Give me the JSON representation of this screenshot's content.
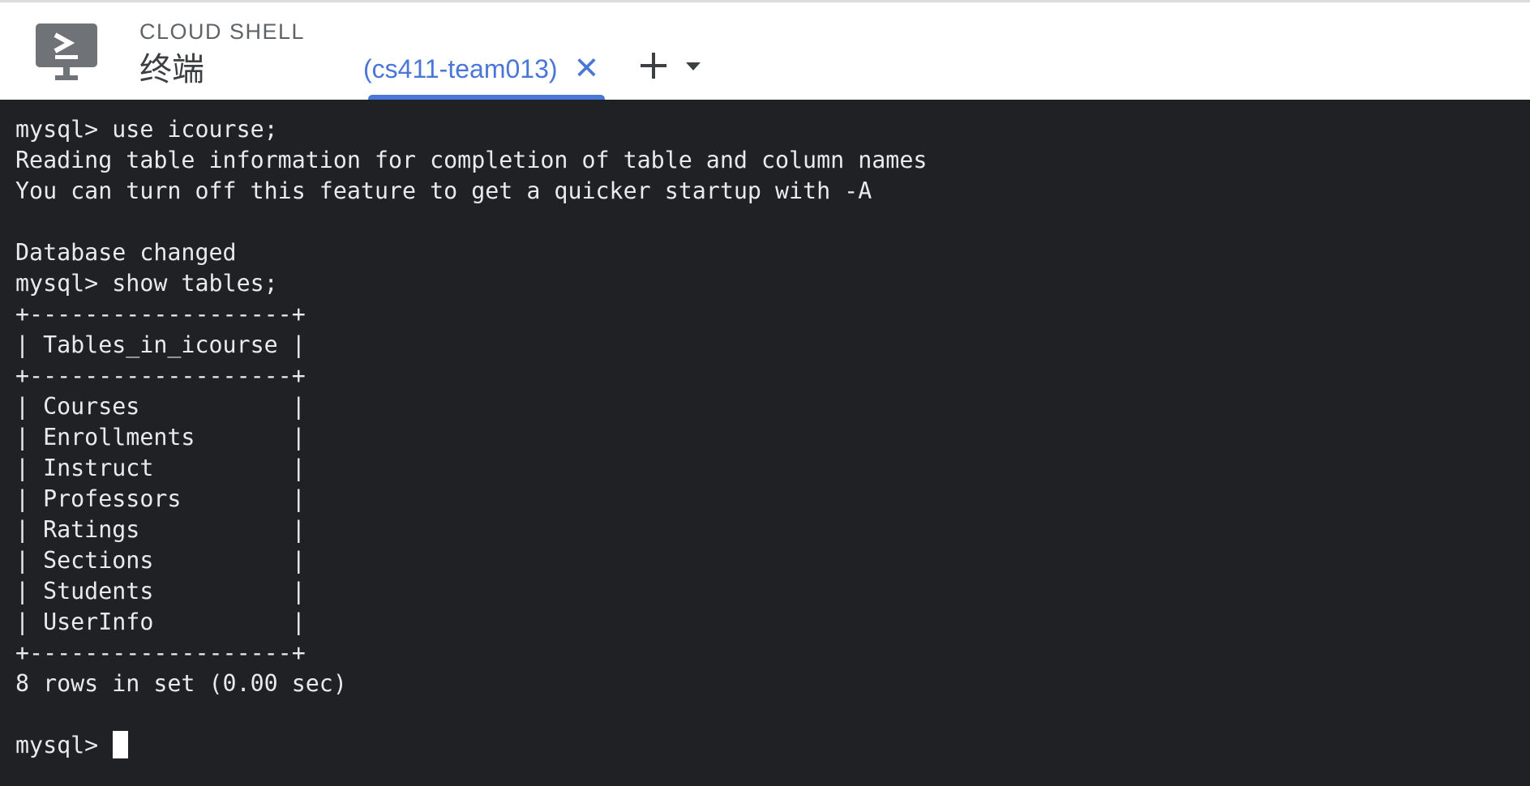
{
  "header": {
    "eyebrow": "CLOUD SHELL",
    "title": "终端",
    "icon": "cloud-shell-terminal-icon"
  },
  "tab": {
    "label": "(cs411-team013)",
    "close_glyph": "✕",
    "close_icon": "close-icon",
    "add_icon": "plus-icon",
    "menu_icon": "caret-down-icon"
  },
  "colors": {
    "accent": "#4a76d8",
    "terminal_bg": "#202124",
    "terminal_fg": "#e8eaed"
  },
  "terminal": {
    "lines": [
      "mysql> use icourse;",
      "Reading table information for completion of table and column names",
      "You can turn off this feature to get a quicker startup with -A",
      "",
      "Database changed",
      "mysql> show tables;",
      "+-------------------+",
      "| Tables_in_icourse |",
      "+-------------------+",
      "| Courses           |",
      "| Enrollments       |",
      "| Instruct          |",
      "| Professors        |",
      "| Ratings           |",
      "| Sections          |",
      "| Students          |",
      "| UserInfo          |",
      "+-------------------+",
      "8 rows in set (0.00 sec)",
      ""
    ],
    "prompt": "mysql>"
  }
}
